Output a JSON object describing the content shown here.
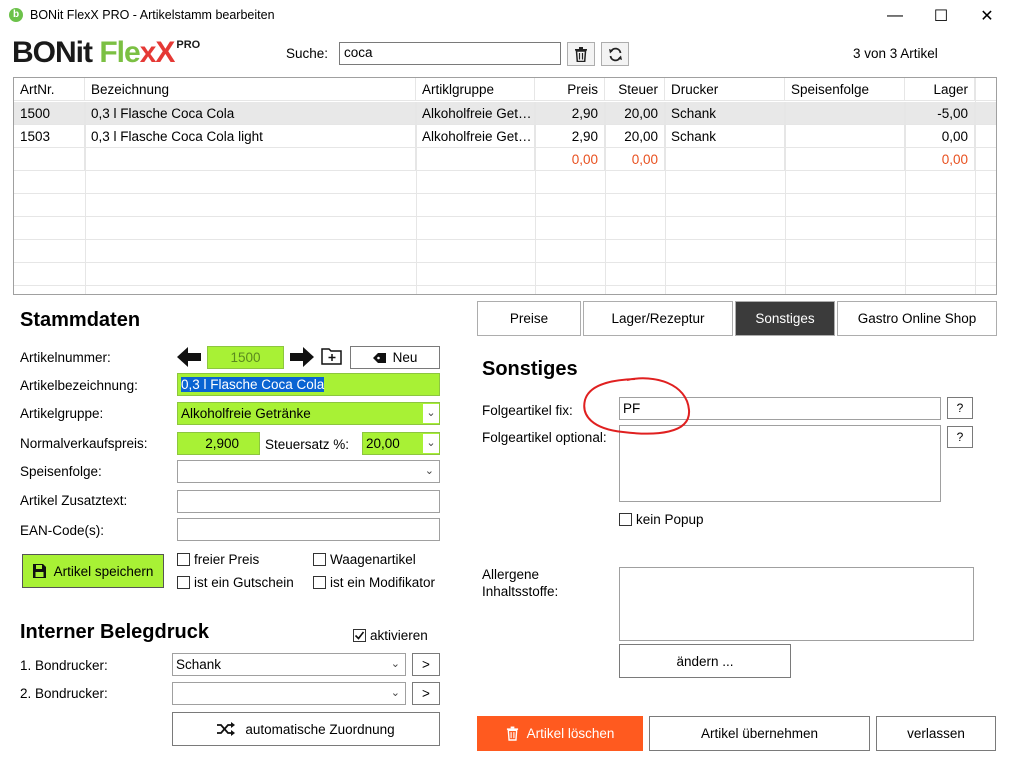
{
  "window": {
    "title": "BONit FlexX PRO - Artikelstamm bearbeiten",
    "app_icon": "b",
    "minimize": "—",
    "maximize": "☐",
    "close": "✕"
  },
  "logo": {
    "part1": "BONit ",
    "part2": "Fle",
    "part3": "xX",
    "pro": "PRO"
  },
  "search": {
    "label": "Suche:",
    "value": "coca"
  },
  "count_text": "3 von 3 Artikel",
  "table": {
    "headers": [
      "ArtNr.",
      "Bezeichnung",
      "Artiklgruppe",
      "Preis",
      "Steuer",
      "Drucker",
      "Speisenfolge",
      "Lager"
    ],
    "rows": [
      [
        "1500",
        "0,3 l Flasche Coca Cola",
        "Alkoholfreie Get…",
        "2,90",
        "20,00",
        "Schank",
        "",
        "-5,00"
      ],
      [
        "1503",
        "0,3 l Flasche Coca Cola light",
        "Alkoholfreie Get…",
        "2,90",
        "20,00",
        "Schank",
        "",
        "0,00"
      ],
      [
        "",
        "",
        "",
        "0,00",
        "0,00",
        "",
        "",
        "0,00"
      ]
    ]
  },
  "tabs": [
    "Preise",
    "Lager/Rezeptur",
    "Sonstiges",
    "Gastro Online Shop"
  ],
  "stammdaten": {
    "title": "Stammdaten",
    "artikelnummer_label": "Artikelnummer:",
    "artikelnummer_value": "1500",
    "neu_label": "Neu",
    "bezeichnung_label": "Artikelbezeichnung:",
    "bezeichnung_value": "0,3 l Flasche Coca Cola",
    "gruppe_label": "Artikelgruppe:",
    "gruppe_value": "Alkoholfreie Getränke",
    "preis_label": "Normalverkaufspreis:",
    "preis_value": "2,900",
    "steuer_label": "Steuersatz %:",
    "steuer_value": "20,00",
    "speisenfolge_label": "Speisenfolge:",
    "zusatztext_label": "Artikel Zusatztext:",
    "ean_label": "EAN-Code(s):",
    "save_label": "Artikel speichern",
    "freier_preis": "freier Preis",
    "waagenartikel": "Waagenartikel",
    "gutschein": "ist ein Gutschein",
    "modifikator": "ist ein Modifikator"
  },
  "belegdruck": {
    "title": "Interner Belegdruck",
    "aktivieren": "aktivieren",
    "drucker1_label": "1. Bondrucker:",
    "drucker1_value": "Schank",
    "drucker2_label": "2. Bondrucker:",
    "more_label": ">",
    "auto_label": "automatische Zuordnung"
  },
  "sonstiges": {
    "title": "Sonstiges",
    "fix_label": "Folgeartikel fix:",
    "fix_value": "PF",
    "optional_label": "Folgeartikel optional:",
    "help_label": "?",
    "kein_popup": "kein Popup",
    "allergene_label1": "Allergene",
    "allergene_label2": "Inhaltsstoffe:",
    "aendern_label": "ändern ..."
  },
  "footer": {
    "delete_label": "Artikel löschen",
    "apply_label": "Artikel übernehmen",
    "leave_label": "verlassen"
  },
  "colors": {
    "accent_green": "#a8f135",
    "delete_orange": "#ff5a1f",
    "tab_active": "#3b3b3b",
    "annotation_red": "#e02020"
  }
}
